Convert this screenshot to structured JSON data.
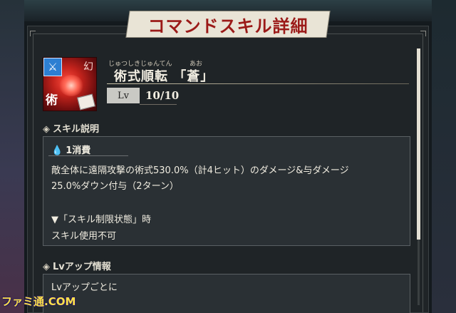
{
  "header": {
    "title": "コマンドスキル詳細"
  },
  "skill": {
    "ruby_left": "じゅつしきじゅんてん",
    "ruby_right": "あお",
    "name": "術式順転 「蒼」",
    "icon": {
      "name": "skill-icon",
      "badge_icon": "sword-icon",
      "badge_glyph": "⚔",
      "top_kanji": "幻",
      "bottom_kanji": "術"
    },
    "level_label": "Lv",
    "level_value": "10/10"
  },
  "sections": {
    "description": {
      "title": "スキル説明",
      "cost": "1消費",
      "cost_icon": "water-drop-icon",
      "lines": [
        "敵全体に遠隔攻撃の術式530.0%（計4ヒット）のダメージ&与ダメージ",
        "25.0%ダウン付与（2ターン）",
        "▼「スキル制限状態」時",
        "スキル使用不可"
      ]
    },
    "lvup": {
      "title": "Lvアップ情報",
      "line": "Lvアップごとに"
    }
  },
  "watermark": "ファミ通.COM",
  "colors": {
    "accent_red": "#9b1a18",
    "cost_blue": "#5ec4ff",
    "badge_blue": "#2d7fd2"
  }
}
